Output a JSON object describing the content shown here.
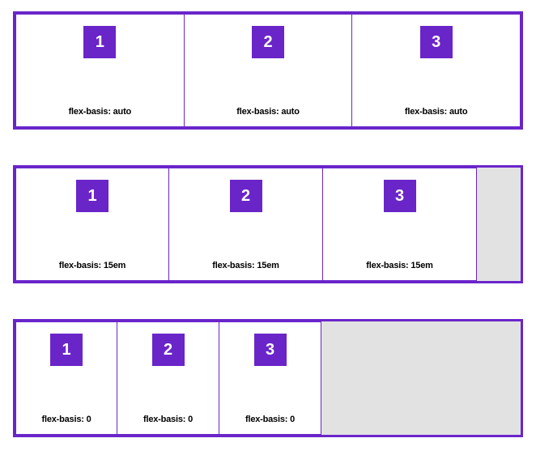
{
  "rows": [
    {
      "class": "row-auto",
      "cells": [
        {
          "num": "1",
          "label": "flex-basis: auto"
        },
        {
          "num": "2",
          "label": "flex-basis: auto"
        },
        {
          "num": "3",
          "label": "flex-basis: auto"
        }
      ]
    },
    {
      "class": "row-15em",
      "cells": [
        {
          "num": "1",
          "label": "flex-basis: 15em"
        },
        {
          "num": "2",
          "label": "flex-basis: 15em"
        },
        {
          "num": "3",
          "label": "flex-basis: 15em"
        }
      ]
    },
    {
      "class": "row-zero",
      "cells": [
        {
          "num": "1",
          "label": "flex-basis: 0"
        },
        {
          "num": "2",
          "label": "flex-basis: 0"
        },
        {
          "num": "3",
          "label": "flex-basis: 0"
        }
      ]
    }
  ]
}
